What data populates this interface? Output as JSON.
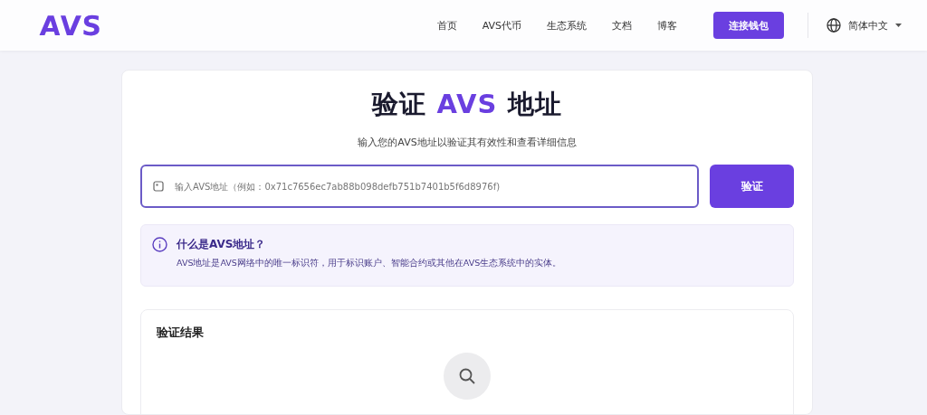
{
  "header": {
    "logo": "AVS",
    "nav": [
      {
        "label": "首页"
      },
      {
        "label": "AVS代币"
      },
      {
        "label": "生态系统"
      },
      {
        "label": "文档"
      },
      {
        "label": "博客"
      }
    ],
    "connect_button": "连接钱包",
    "language": "简体中文"
  },
  "main": {
    "title": {
      "before": "验证",
      "highlight": "AVS",
      "after": "地址"
    },
    "subtitle": "输入您的AVS地址以验证其有效性和查看详细信息",
    "address_input": {
      "placeholder": "输入AVS地址（例如：0x71c7656ec7ab88b098defb751b7401b5f6d8976f)"
    },
    "verify_button": "验证",
    "info": {
      "title": "什么是AVS地址？",
      "text": "AVS地址是AVS网络中的唯一标识符，用于标识账户、智能合约或其他在AVS生态系统中的实体。"
    },
    "results": {
      "title": "验证结果"
    }
  }
}
